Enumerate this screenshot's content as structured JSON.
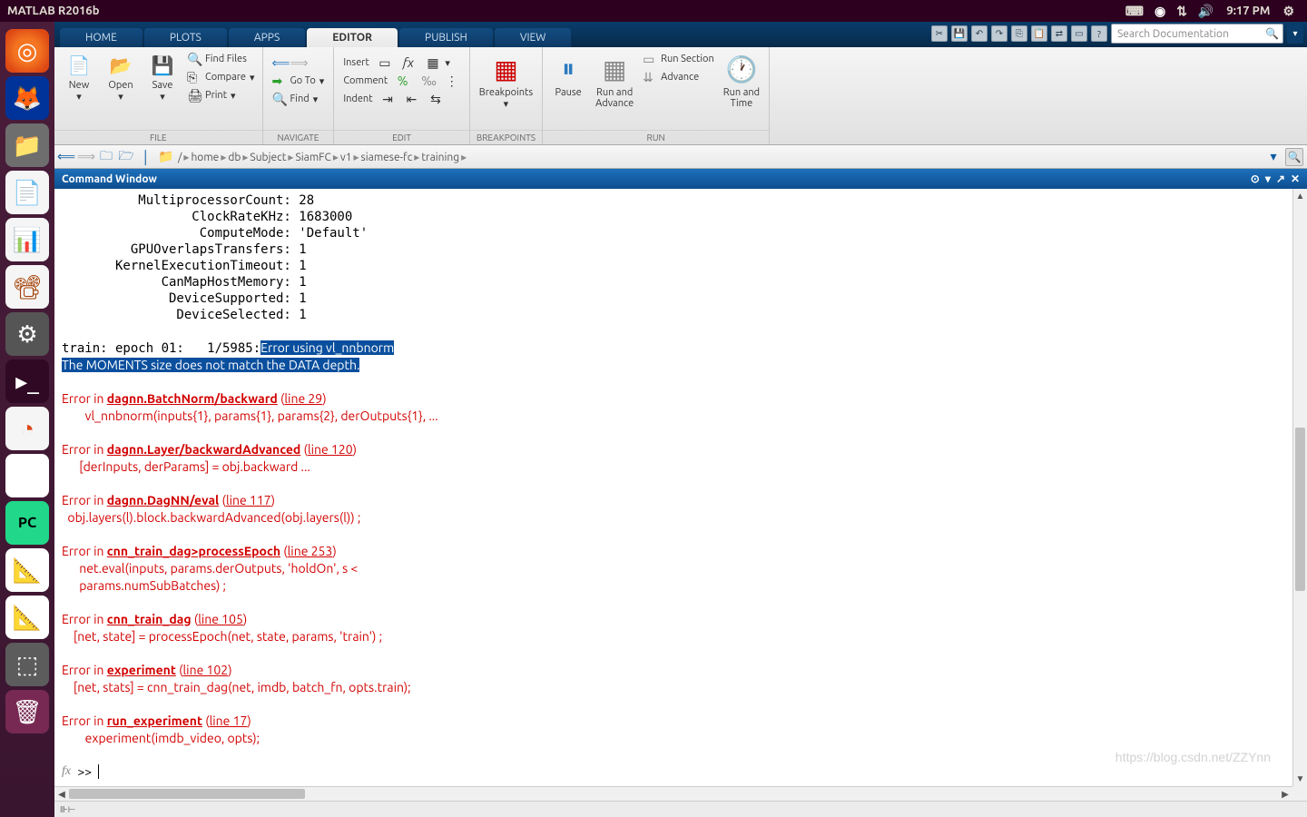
{
  "ubuntu": {
    "title": "MATLAB R2016b",
    "clock": "9:17 PM"
  },
  "tabs": [
    {
      "label": "HOME",
      "active": false
    },
    {
      "label": "PLOTS",
      "active": false
    },
    {
      "label": "APPS",
      "active": false
    },
    {
      "label": "EDITOR",
      "active": true
    },
    {
      "label": "PUBLISH",
      "active": false
    },
    {
      "label": "VIEW",
      "active": false
    }
  ],
  "search": {
    "placeholder": "Search Documentation"
  },
  "ribbon": {
    "file": {
      "label": "FILE",
      "new": "New",
      "open": "Open",
      "save": "Save",
      "find_files": "Find Files",
      "compare": "Compare",
      "print": "Print"
    },
    "navigate": {
      "label": "NAVIGATE",
      "goto": "Go To",
      "find": "Find"
    },
    "edit": {
      "label": "EDIT",
      "insert": "Insert",
      "comment": "Comment",
      "indent": "Indent"
    },
    "breakpoints": {
      "label": "BREAKPOINTS",
      "bp": "Breakpoints"
    },
    "run": {
      "label": "RUN",
      "pause": "Pause",
      "run_adv": "Run and\nAdvance",
      "run_section": "Run Section",
      "advance": "Advance",
      "run_time": "Run and\nTime"
    }
  },
  "path": {
    "crumbs": [
      "/",
      "home",
      "db",
      "Subject",
      "SiamFC",
      "v1",
      "siamese-fc",
      "training"
    ]
  },
  "cw_title": "Command Window",
  "output": {
    "props": [
      {
        "k": "MultiprocessorCount",
        "v": "28"
      },
      {
        "k": "ClockRateKHz",
        "v": "1683000"
      },
      {
        "k": "ComputeMode",
        "v": "'Default'"
      },
      {
        "k": "GPUOverlapsTransfers",
        "v": "1"
      },
      {
        "k": "KernelExecutionTimeout",
        "v": "1"
      },
      {
        "k": "CanMapHostMemory",
        "v": "1"
      },
      {
        "k": "DeviceSupported",
        "v": "1"
      },
      {
        "k": "DeviceSelected",
        "v": "1"
      }
    ],
    "train_prefix": "train: epoch 01:   1/5985:",
    "sel_err1": "Error using vl_nnbnorm",
    "sel_err2": "The MOMENTS size does not match the DATA depth.",
    "stack": [
      {
        "pre": "Error in ",
        "fn": "dagnn.BatchNorm/backward",
        "mid": " (",
        "line": "line 29",
        "post": ")",
        "body": "        vl_nnbnorm(inputs{1}, params{1}, params{2}, derOutputs{1}, ..."
      },
      {
        "pre": "Error in ",
        "fn": "dagnn.Layer/backwardAdvanced",
        "mid": " (",
        "line": "line 120",
        "post": ")",
        "body": "      [derInputs, derParams] = obj.backward ..."
      },
      {
        "pre": "Error in ",
        "fn": "dagnn.DagNN/eval",
        "mid": " (",
        "line": "line 117",
        "post": ")",
        "body": "  obj.layers(l).block.backwardAdvanced(obj.layers(l)) ;"
      },
      {
        "pre": "Error in ",
        "fn": "cnn_train_dag>processEpoch",
        "mid": " (",
        "line": "line 253",
        "post": ")",
        "body": "      net.eval(inputs, params.derOutputs, 'holdOn', s <\n      params.numSubBatches) ;"
      },
      {
        "pre": "Error in ",
        "fn": "cnn_train_dag",
        "mid": " (",
        "line": "line 105",
        "post": ")",
        "body": "    [net, state] = processEpoch(net, state, params, 'train') ;"
      },
      {
        "pre": "Error in ",
        "fn": "experiment",
        "mid": " (",
        "line": "line 102",
        "post": ")",
        "body": "    [net, stats] = cnn_train_dag(net, imdb, batch_fn, opts.train);"
      },
      {
        "pre": "Error in ",
        "fn": "run_experiment",
        "mid": " (",
        "line": "line 17",
        "post": ")",
        "body": "        experiment(imdb_video, opts);"
      }
    ],
    "prompt": ">> "
  },
  "watermark": "https://blog.csdn.net/ZZYnn"
}
